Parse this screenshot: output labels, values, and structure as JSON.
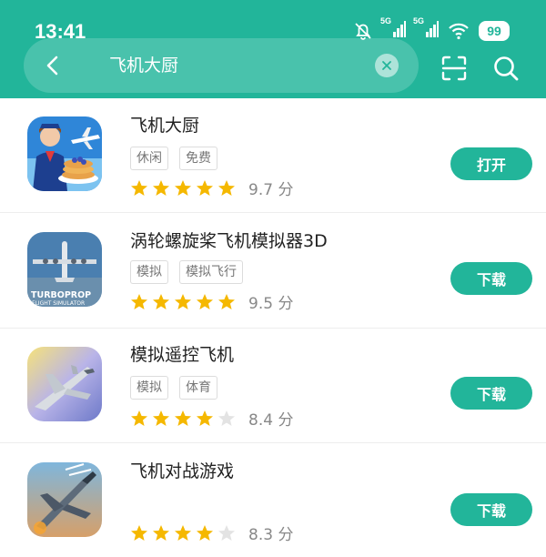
{
  "status_bar": {
    "time": "13:41",
    "network_label_1": "5G",
    "network_label_2": "5G",
    "battery": "99"
  },
  "search": {
    "query": "飞机大厨"
  },
  "colors": {
    "accent": "#22b59a",
    "star_filled": "#f5b800",
    "star_empty": "#e3e3e3"
  },
  "apps": [
    {
      "name": "飞机大厨",
      "tags": [
        "休闲",
        "免费"
      ],
      "stars": 5,
      "score": "9.7 分",
      "action": "打开"
    },
    {
      "name": "涡轮螺旋桨飞机模拟器3D",
      "tags": [
        "模拟",
        "模拟飞行"
      ],
      "stars": 5,
      "score": "9.5 分",
      "action": "下载",
      "icon_caption_1": "TURBOPROP",
      "icon_caption_2": "FLIGHT SIMULATOR"
    },
    {
      "name": "模拟遥控飞机",
      "tags": [
        "模拟",
        "体育"
      ],
      "stars": 4,
      "score": "8.4 分",
      "action": "下载"
    },
    {
      "name": "飞机对战游戏",
      "tags": [],
      "stars": 4,
      "score": "8.3 分",
      "action": "下载"
    }
  ]
}
